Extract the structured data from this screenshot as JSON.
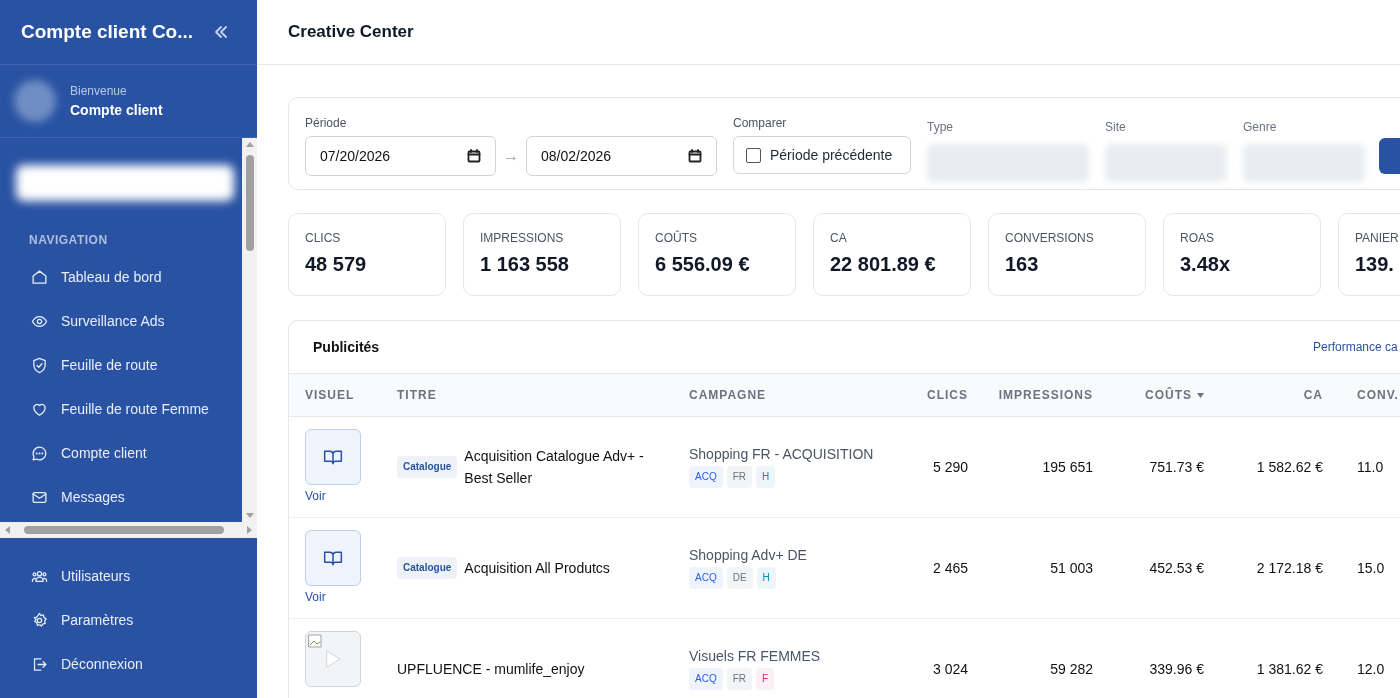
{
  "sidebar": {
    "title": "Compte client Co...",
    "user": {
      "greeting": "Bienvenue",
      "name": "Compte client"
    },
    "section_label": "NAVIGATION",
    "nav_items": [
      {
        "label": "Tableau de bord"
      },
      {
        "label": "Surveillance Ads"
      },
      {
        "label": "Feuille de route"
      },
      {
        "label": "Feuille de route Femme"
      },
      {
        "label": "Compte client"
      },
      {
        "label": "Messages"
      }
    ],
    "bottom_items": [
      {
        "label": "Utilisateurs"
      },
      {
        "label": "Paramètres"
      },
      {
        "label": "Déconnexion"
      }
    ]
  },
  "header": {
    "title": "Creative Center"
  },
  "filters": {
    "period_label": "Période",
    "date_from": "07/20/2026",
    "date_to": "08/02/2026",
    "arrow": "→",
    "compare_label": "Comparer",
    "compare_option": {
      "label": "Période précédente",
      "checked": false
    },
    "selects": [
      {
        "label": "Type"
      },
      {
        "label": "Site"
      },
      {
        "label": "Genre"
      }
    ]
  },
  "kpis": [
    {
      "label": "CLICS",
      "value": "48 579"
    },
    {
      "label": "IMPRESSIONS",
      "value": "1 163 558"
    },
    {
      "label": "COÛTS",
      "value": "6 556.09 €"
    },
    {
      "label": "CA",
      "value": "22 801.89 €"
    },
    {
      "label": "CONVERSIONS",
      "value": "163"
    },
    {
      "label": "ROAS",
      "value": "3.48x"
    },
    {
      "label": "PANIER",
      "value": "139."
    }
  ],
  "table": {
    "title": "Publicités",
    "link": "Performance ca",
    "columns": [
      {
        "label": "VISUEL",
        "sorted": false
      },
      {
        "label": "TITRE",
        "sorted": false
      },
      {
        "label": "CAMPAGNE",
        "sorted": false
      },
      {
        "label": "CLICS",
        "sorted": false
      },
      {
        "label": "IMPRESSIONS",
        "sorted": false
      },
      {
        "label": "COÛTS",
        "sorted": true
      },
      {
        "label": "CA",
        "sorted": false
      },
      {
        "label": "CONV.",
        "sorted": false
      }
    ],
    "rows": [
      {
        "visual": {
          "kind": "catalogue",
          "link": "Voir"
        },
        "badge": "Catalogue",
        "title": "Acquisition Catalogue Adv+ - Best Seller",
        "campaign": "Shopping FR - ACQUISITION",
        "tags": [
          {
            "label": "ACQ",
            "color": "#2563eb"
          },
          {
            "label": "FR",
            "color": "#6b7280"
          },
          {
            "label": "H",
            "color": "#0891b2"
          }
        ],
        "clics": "5 290",
        "impressions": "195 651",
        "couts": "751.73 €",
        "ca": "1 582.62 €",
        "conv": "11.0"
      },
      {
        "visual": {
          "kind": "catalogue",
          "link": "Voir"
        },
        "badge": "Catalogue",
        "title": "Acquisition All Produtcs",
        "campaign": "Shopping Adv+ DE",
        "tags": [
          {
            "label": "ACQ",
            "color": "#2563eb"
          },
          {
            "label": "DE",
            "color": "#6b7280"
          },
          {
            "label": "H",
            "color": "#0891b2"
          }
        ],
        "clics": "2 465",
        "impressions": "51 003",
        "couts": "452.53 €",
        "ca": "2 172.18 €",
        "conv": "15.0"
      },
      {
        "visual": {
          "kind": "video"
        },
        "title": "UPFLUENCE - mumlife_enjoy",
        "campaign": "Visuels FR FEMMES",
        "tags": [
          {
            "label": "ACQ",
            "color": "#2563eb"
          },
          {
            "label": "FR",
            "color": "#6b7280"
          },
          {
            "label": "F",
            "color": "#db2777"
          }
        ],
        "clics": "3 024",
        "impressions": "59 282",
        "couts": "339.96 €",
        "ca": "1 381.62 €",
        "conv": "12.0"
      }
    ]
  }
}
